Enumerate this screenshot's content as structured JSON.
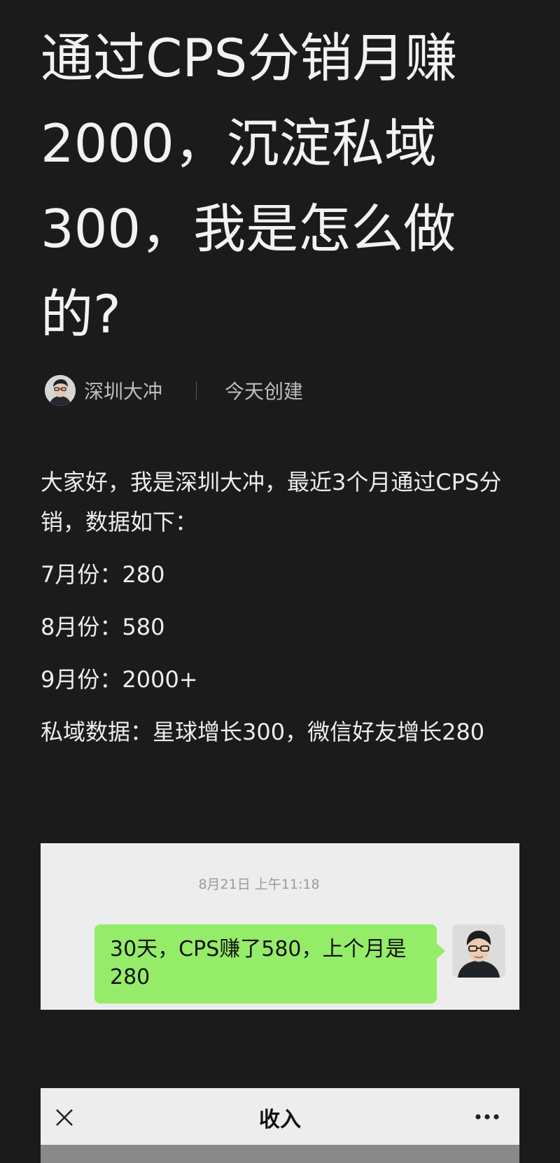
{
  "article": {
    "title_lines": [
      "通过CPS分销月赚",
      "2000，沉淀私域",
      "300，我是怎么做",
      "的?"
    ],
    "author": "深圳大冲",
    "created": "今天创建",
    "paragraphs": [
      "大家好，我是深圳大冲，最近3个月通过CPS分销，数据如下：",
      "7月份：280",
      "8月份：580",
      "9月份：2000+",
      "私域数据：星球增长300，微信好友增长280"
    ]
  },
  "chat_screenshot": {
    "timestamp": "8月21日 上午11:18",
    "message": "30天，CPS赚了580，上个月是280"
  },
  "income_screenshot": {
    "nav_title": "收入",
    "close_icon": "close-icon",
    "more_icon": "more-icon"
  },
  "colors": {
    "page_background": "#1b1b1b",
    "chat_bubble": "#95ec69",
    "screenshot_background": "#ededed"
  }
}
